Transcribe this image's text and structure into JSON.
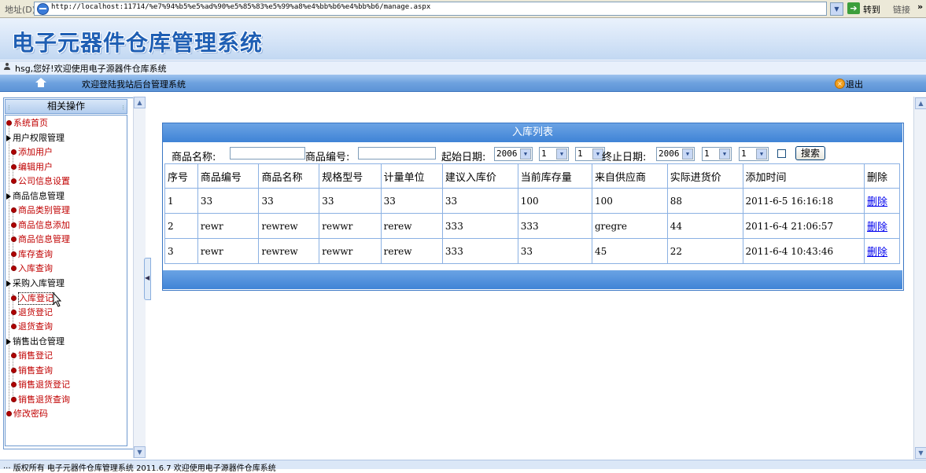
{
  "browser": {
    "address_label": "地址(D)",
    "url": "http://localhost:11714/%e7%94%b5%e5%ad%90%e5%85%83%e5%99%a8%e4%bb%b6%e4%bb%b6/manage.aspx",
    "go_label": "转到",
    "links_label": "链接",
    "links_chevron": "»"
  },
  "header": {
    "site_title": "电子元器件仓库管理系统",
    "welcome_text": "hsg,您好!欢迎使用电子源器件仓库系统",
    "nav_welcome": "欢迎登陆我站后台管理系统",
    "logout_label": "退出"
  },
  "sidebar": {
    "title": "相关操作",
    "items": [
      {
        "label": "系统首页",
        "type": "leaf"
      },
      {
        "label": "用户权限管理",
        "type": "group"
      },
      {
        "label": "添加用户",
        "type": "leaf"
      },
      {
        "label": "编辑用户",
        "type": "leaf"
      },
      {
        "label": "公司信息设置",
        "type": "leaf"
      },
      {
        "label": "商品信息管理",
        "type": "group"
      },
      {
        "label": "商品类别管理",
        "type": "leaf"
      },
      {
        "label": "商品信息添加",
        "type": "leaf"
      },
      {
        "label": "商品信息管理",
        "type": "leaf"
      },
      {
        "label": "库存查询",
        "type": "leaf"
      },
      {
        "label": "入库查询",
        "type": "leaf"
      },
      {
        "label": "采购入库管理",
        "type": "group"
      },
      {
        "label": "入库登记",
        "type": "leaf"
      },
      {
        "label": "退货登记",
        "type": "leaf"
      },
      {
        "label": "退货查询",
        "type": "leaf"
      },
      {
        "label": "销售出仓管理",
        "type": "group"
      },
      {
        "label": "销售登记",
        "type": "leaf"
      },
      {
        "label": "销售查询",
        "type": "leaf"
      },
      {
        "label": "销售退货登记",
        "type": "leaf"
      },
      {
        "label": "销售退货查询",
        "type": "leaf"
      },
      {
        "label": "修改密码",
        "type": "leaf"
      }
    ]
  },
  "list": {
    "title": "入库列表",
    "search": {
      "name_label": "商品名称:",
      "name_value": "",
      "code_label": "商品编号:",
      "code_value": "",
      "start_label": "起始日期:",
      "start_year": "2006",
      "start_month": "1",
      "start_day": "1",
      "end_label": "终止日期:",
      "end_year": "2006",
      "end_month": "1",
      "end_day": "1",
      "checkbox_checked": false,
      "search_button": "搜索"
    },
    "columns": [
      "序号",
      "商品编号",
      "商品名称",
      "规格型号",
      "计量单位",
      "建议入库价",
      "当前库存量",
      "来自供应商",
      "实际进货价",
      "添加时间",
      "删除"
    ],
    "rows": [
      [
        "1",
        "33",
        "33",
        "33",
        "33",
        "33",
        "100",
        "100",
        "88",
        "2011-6-5 16:16:18",
        "删除"
      ],
      [
        "2",
        "rewr",
        "rewrew",
        "rewwr",
        "rerew",
        "333",
        "333",
        "gregre",
        "44",
        "2011-6-4 21:06:57",
        "删除"
      ],
      [
        "3",
        "rewr",
        "rewrew",
        "rewwr",
        "rerew",
        "333",
        "33",
        "45",
        "22",
        "2011-6-4 10:43:46",
        "删除"
      ]
    ]
  },
  "status_text": "··· 版权所有 电子元器件仓库管理系统 2011.6.7 欢迎使用电子源器件仓库系统"
}
